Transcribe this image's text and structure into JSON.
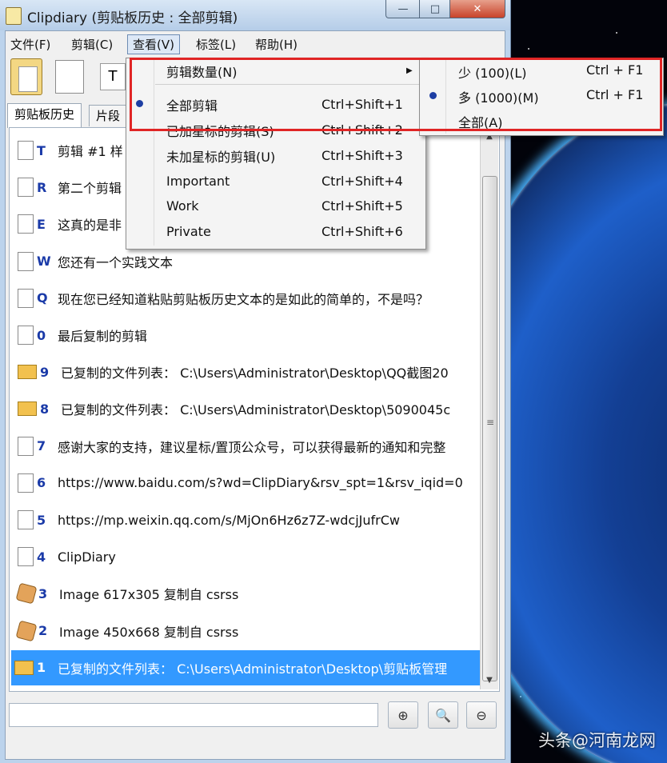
{
  "window": {
    "title": "Clipdiary (剪贴板历史 : 全部剪辑)",
    "minimize": "—",
    "maximize": "□",
    "close": "✕"
  },
  "menubar": [
    "文件(F)",
    "剪辑(C)",
    "查看(V)",
    "标签(L)",
    "帮助(H)"
  ],
  "toolbar": {
    "text_button": "T"
  },
  "tabs": [
    "剪贴板历史",
    "片段"
  ],
  "clips": [
    {
      "key": "T",
      "icon": "doc",
      "text": "剪辑 #1 样"
    },
    {
      "key": "R",
      "icon": "doc",
      "text": "第二个剪辑"
    },
    {
      "key": "E",
      "icon": "doc",
      "text": "这真的是非"
    },
    {
      "key": "W",
      "icon": "doc",
      "text": "您还有一个实践文本"
    },
    {
      "key": "Q",
      "icon": "doc",
      "text": "现在您已经知道粘贴剪贴板历史文本的是如此的简单的，不是吗？"
    },
    {
      "key": "0",
      "icon": "doc",
      "text": "最后复制的剪辑"
    },
    {
      "key": "9",
      "icon": "folder",
      "text": "已复制的文件列表：   C:\\Users\\Administrator\\Desktop\\QQ截图20"
    },
    {
      "key": "8",
      "icon": "folder",
      "text": "已复制的文件列表：   C:\\Users\\Administrator\\Desktop\\5090045c"
    },
    {
      "key": "7",
      "icon": "doc",
      "text": "感谢大家的支持，建议星标/置顶公众号，可以获得最新的通知和完整"
    },
    {
      "key": "6",
      "icon": "doc",
      "text": "https://www.baidu.com/s?wd=ClipDiary&rsv_spt=1&rsv_iqid=0"
    },
    {
      "key": "5",
      "icon": "doc",
      "text": "https://mp.weixin.qq.com/s/MjOn6Hz6z7Z-wdcjJufrCw"
    },
    {
      "key": "4",
      "icon": "doc",
      "text": "ClipDiary"
    },
    {
      "key": "3",
      "icon": "image",
      "text": "Image 617x305 复制自 csrss"
    },
    {
      "key": "2",
      "icon": "image",
      "text": "Image 450x668 复制自 csrss"
    },
    {
      "key": "1",
      "icon": "folder",
      "text": "已复制的文件列表：   C:\\Users\\Administrator\\Desktop\\剪贴板管理",
      "selected": true
    }
  ],
  "view_menu": [
    {
      "label": "剪辑数量(N)",
      "shortcut": "",
      "submenu": true
    },
    {
      "label": "全部剪辑",
      "shortcut": "Ctrl+Shift+1",
      "checked": true
    },
    {
      "label": "已加星标的剪辑(S)",
      "shortcut": "Ctrl+Shift+2"
    },
    {
      "label": "未加星标的剪辑(U)",
      "shortcut": "Ctrl+Shift+3"
    },
    {
      "label": "Important",
      "shortcut": "Ctrl+Shift+4"
    },
    {
      "label": "Work",
      "shortcut": "Ctrl+Shift+5"
    },
    {
      "label": "Private",
      "shortcut": "Ctrl+Shift+6"
    }
  ],
  "count_submenu": [
    {
      "label": "少 (100)(L)",
      "shortcut": "Ctrl + F1"
    },
    {
      "label": "多 (1000)(M)",
      "shortcut": "Ctrl + F1",
      "checked": true
    },
    {
      "label": "全部(A)",
      "shortcut": ""
    }
  ],
  "zoom_buttons": [
    "⊕",
    "🔍",
    "⊖"
  ],
  "watermark": "头条@河南龙网",
  "colors": {
    "highlight_border": "#e02525",
    "selection": "#3399ff",
    "key_blue": "#1a3aa8"
  }
}
